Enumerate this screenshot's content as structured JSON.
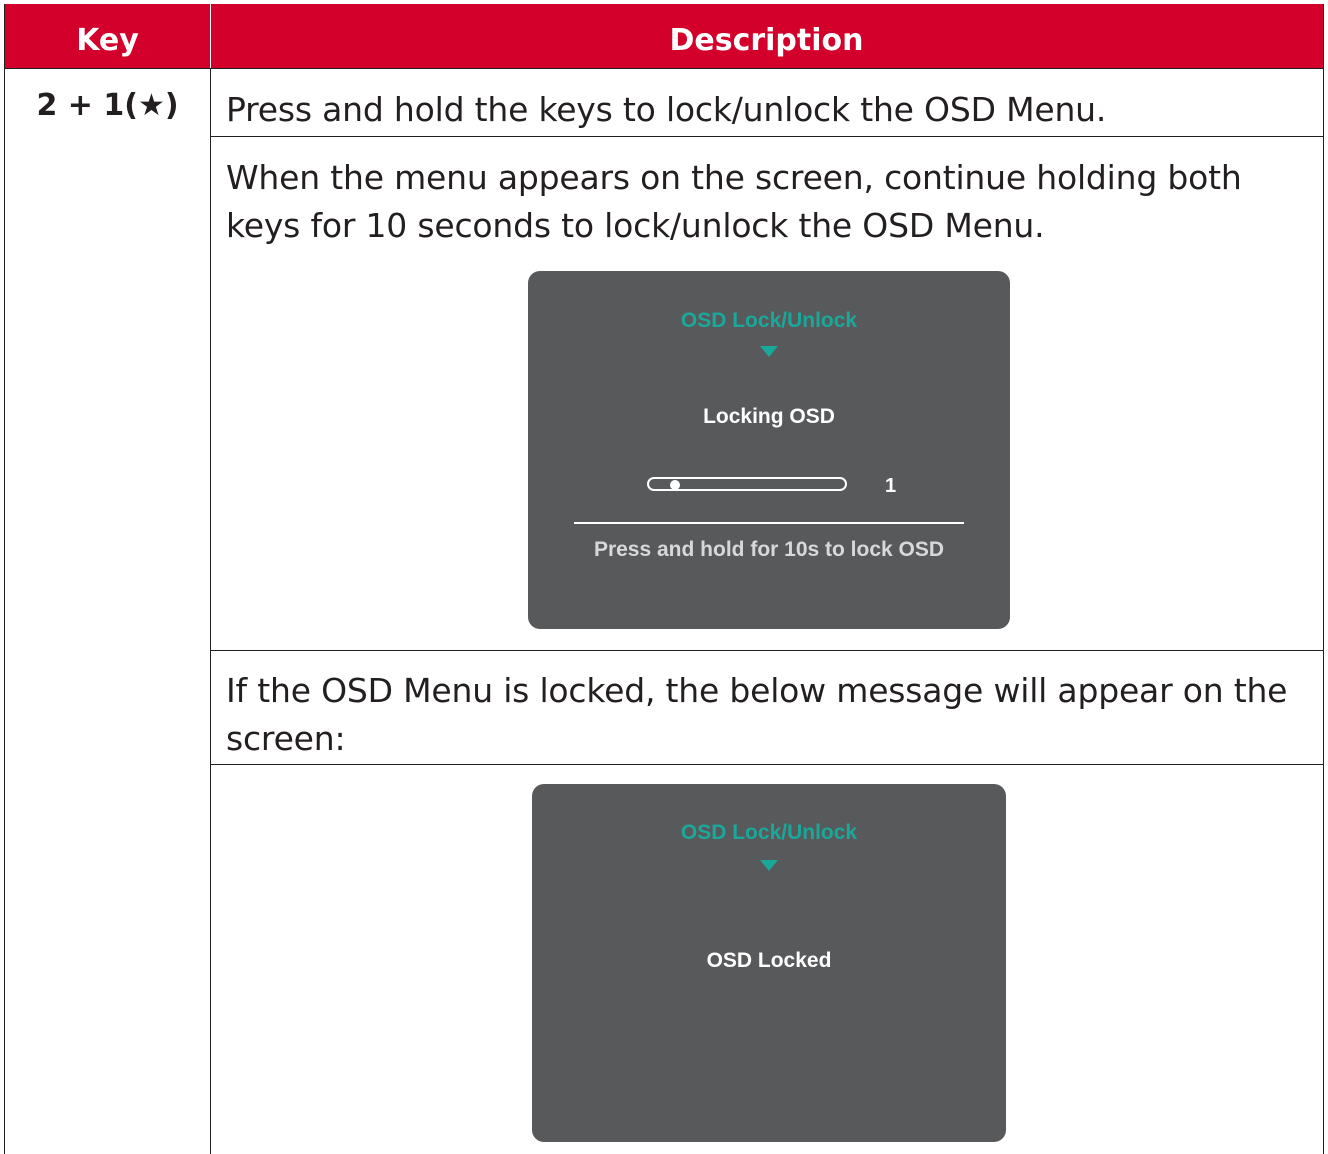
{
  "table": {
    "header": {
      "key_label": "Key",
      "description_label": "Description"
    },
    "row": {
      "key": "2 + 1(★)",
      "paragraphs": [
        "Press and hold the keys to lock/unlock the OSD Menu.",
        "When the menu appears on the screen, continue holding both keys for 10 seconds to lock/unlock the OSD Menu.",
        "If the OSD Menu is locked, the below message will appear on the screen:"
      ]
    }
  },
  "osd_locking": {
    "title": "OSD Lock/Unlock",
    "message": "Locking OSD",
    "slider_fraction": 0.1,
    "count": "1",
    "hint": "Press and hold for 10s to lock OSD"
  },
  "osd_locked": {
    "title": "OSD Lock/Unlock",
    "message": "OSD Locked"
  },
  "colors": {
    "header_background": "#d2002a",
    "osd_background": "#58595b",
    "osd_accent": "#1aa89a"
  },
  "icons": {
    "key_symbol": "star-icon",
    "osd_indicator": "down-triangle-icon"
  }
}
